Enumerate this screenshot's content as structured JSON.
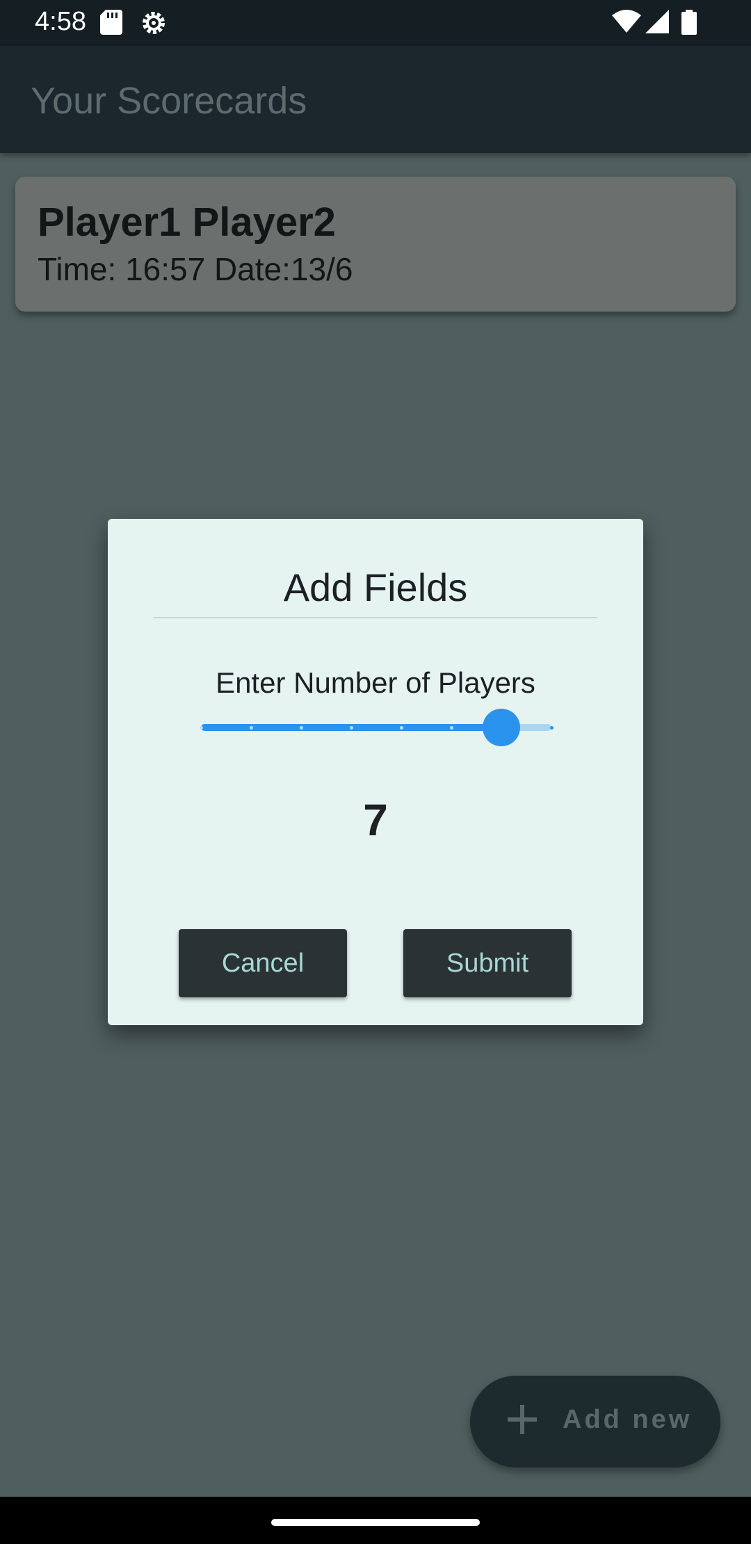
{
  "status_bar": {
    "time": "4:58",
    "icons_left": [
      "sd-card-icon",
      "settings-icon"
    ],
    "icons_right": [
      "wifi-icon",
      "signal-icon",
      "battery-icon"
    ]
  },
  "app_bar": {
    "title": "Your Scorecards"
  },
  "scorecards": [
    {
      "players": "Player1 Player2",
      "meta": "Time: 16:57 Date:13/6"
    }
  ],
  "dialog": {
    "title": "Add Fields",
    "prompt": "Enter Number of Players",
    "slider": {
      "min": 1,
      "max": 8,
      "value": 7,
      "value_label": "7"
    },
    "cancel_label": "Cancel",
    "submit_label": "Submit"
  },
  "fab": {
    "label": "Add new",
    "icon": "plus-icon"
  },
  "colors": {
    "accent": "#2a93ee",
    "dialog_bg": "#e6f4f1",
    "button_bg": "#2a3233",
    "button_text": "#a8d8d5",
    "scrim_bg": "#4f5e5e"
  }
}
